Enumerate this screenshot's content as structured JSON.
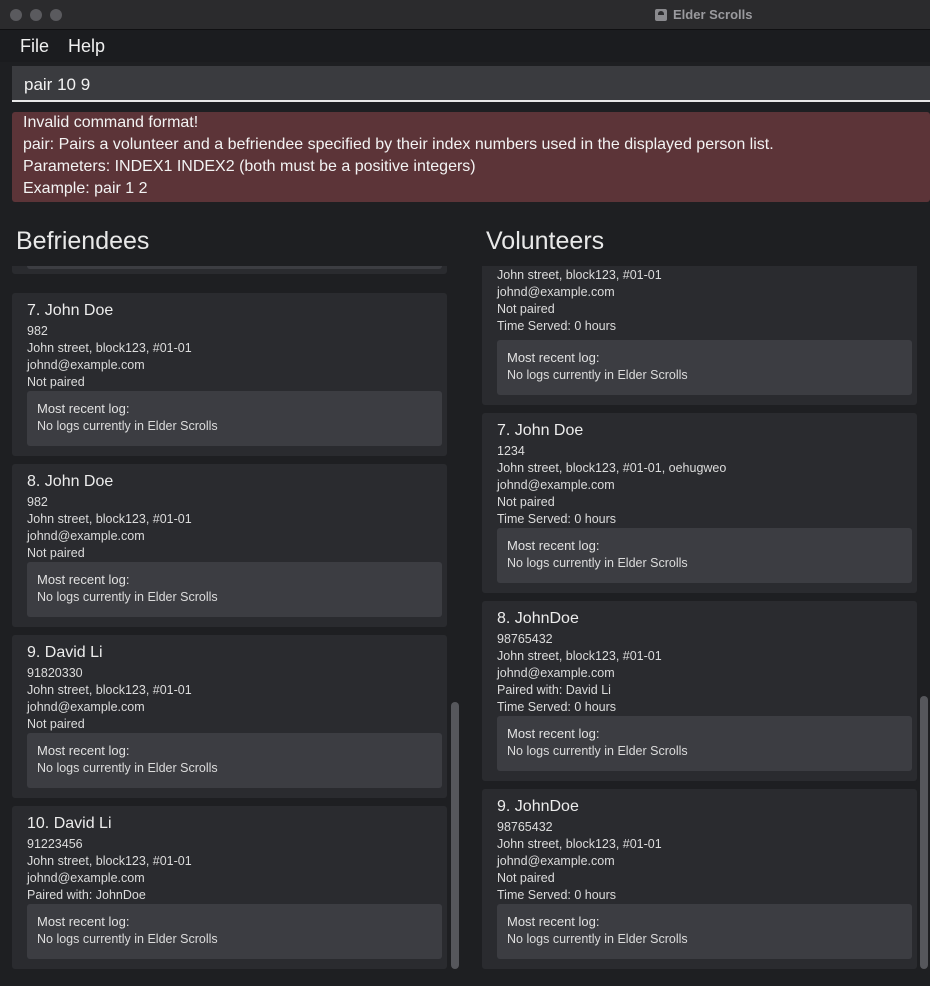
{
  "window": {
    "title": "Elder Scrolls"
  },
  "menu": {
    "file": "File",
    "help": "Help"
  },
  "command": {
    "value": "pair 10 9"
  },
  "result": {
    "lines": [
      "Invalid command format!",
      "pair: Pairs a volunteer and a befriendee specified by their index numbers used in the displayed person list.",
      "Parameters: INDEX1 INDEX2 (both must be a positive integers)",
      "Example: pair 1 2"
    ]
  },
  "befriendees": {
    "title": "Befriendees",
    "cards": [
      {
        "name": "7.  John Doe",
        "lines": [
          "982",
          "John street, block123, #01-01",
          "johnd@example.com",
          "Not paired"
        ],
        "log_title": "Most recent log:",
        "log_value": "No logs currently in Elder Scrolls"
      },
      {
        "name": "8.  John Doe",
        "lines": [
          "982",
          "John street, block123, #01-01",
          "johnd@example.com",
          "Not paired"
        ],
        "log_title": "Most recent log:",
        "log_value": "No logs currently in Elder Scrolls"
      },
      {
        "name": "9.  David Li",
        "lines": [
          "91820330",
          "John street, block123, #01-01",
          "johnd@example.com",
          "Not paired"
        ],
        "log_title": "Most recent log:",
        "log_value": "No logs currently in Elder Scrolls"
      },
      {
        "name": "10.  David Li",
        "lines": [
          "91223456",
          "John street, block123, #01-01",
          "johnd@example.com",
          "Paired with: JohnDoe"
        ],
        "log_title": "Most recent log:",
        "log_value": "No logs currently in Elder Scrolls"
      }
    ]
  },
  "volunteers": {
    "title": "Volunteers",
    "partial_card": {
      "lines": [
        "John street, block123, #01-01",
        "johnd@example.com",
        "Not paired",
        "Time Served: 0 hours"
      ],
      "log_title": "Most recent log:",
      "log_value": "No logs currently in Elder Scrolls"
    },
    "cards": [
      {
        "name": "7.  John Doe",
        "lines": [
          "1234",
          "John street, block123, #01-01, oehugweo",
          "johnd@example.com",
          "Not paired",
          "Time Served: 0 hours"
        ],
        "log_title": "Most recent log:",
        "log_value": "No logs currently in Elder Scrolls"
      },
      {
        "name": "8.  JohnDoe",
        "lines": [
          "98765432",
          "John street, block123, #01-01",
          "johnd@example.com",
          "Paired with: David Li",
          "Time Served: 0 hours"
        ],
        "log_title": "Most recent log:",
        "log_value": "No logs currently in Elder Scrolls"
      },
      {
        "name": "9.  JohnDoe",
        "lines": [
          "98765432",
          "John street, block123, #01-01",
          "johnd@example.com",
          "Not paired",
          "Time Served: 0 hours"
        ],
        "log_title": "Most recent log:",
        "log_value": "No logs currently in Elder Scrolls"
      }
    ]
  }
}
